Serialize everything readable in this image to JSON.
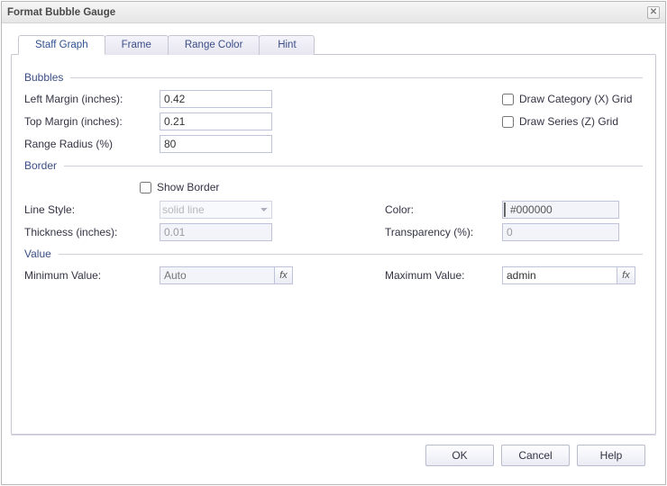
{
  "title": "Format Bubble Gauge",
  "tabs": [
    {
      "label": "Staff Graph"
    },
    {
      "label": "Frame"
    },
    {
      "label": "Range Color"
    },
    {
      "label": "Hint"
    }
  ],
  "sections": {
    "bubbles": "Bubbles",
    "border": "Border",
    "value": "Value"
  },
  "labels": {
    "left_margin": "Left Margin (inches):",
    "top_margin": "Top Margin (inches):",
    "range_radius": "Range Radius (%)",
    "draw_x_grid": "Draw Category (X) Grid",
    "draw_z_grid": "Draw Series (Z) Grid",
    "show_border": "Show Border",
    "line_style": "Line Style:",
    "thickness": "Thickness (inches):",
    "color": "Color:",
    "transparency": "Transparency (%):",
    "min_value": "Minimum Value:",
    "max_value": "Maximum Value:"
  },
  "values": {
    "left_margin": "0.42",
    "top_margin": "0.21",
    "range_radius": "80",
    "line_style": "solid line",
    "thickness": "0.01",
    "color_hex": "#000000",
    "transparency": "0",
    "min_value_placeholder": "Auto",
    "max_value": "admin"
  },
  "buttons": {
    "ok": "OK",
    "cancel": "Cancel",
    "help": "Help",
    "fx": "fx"
  }
}
